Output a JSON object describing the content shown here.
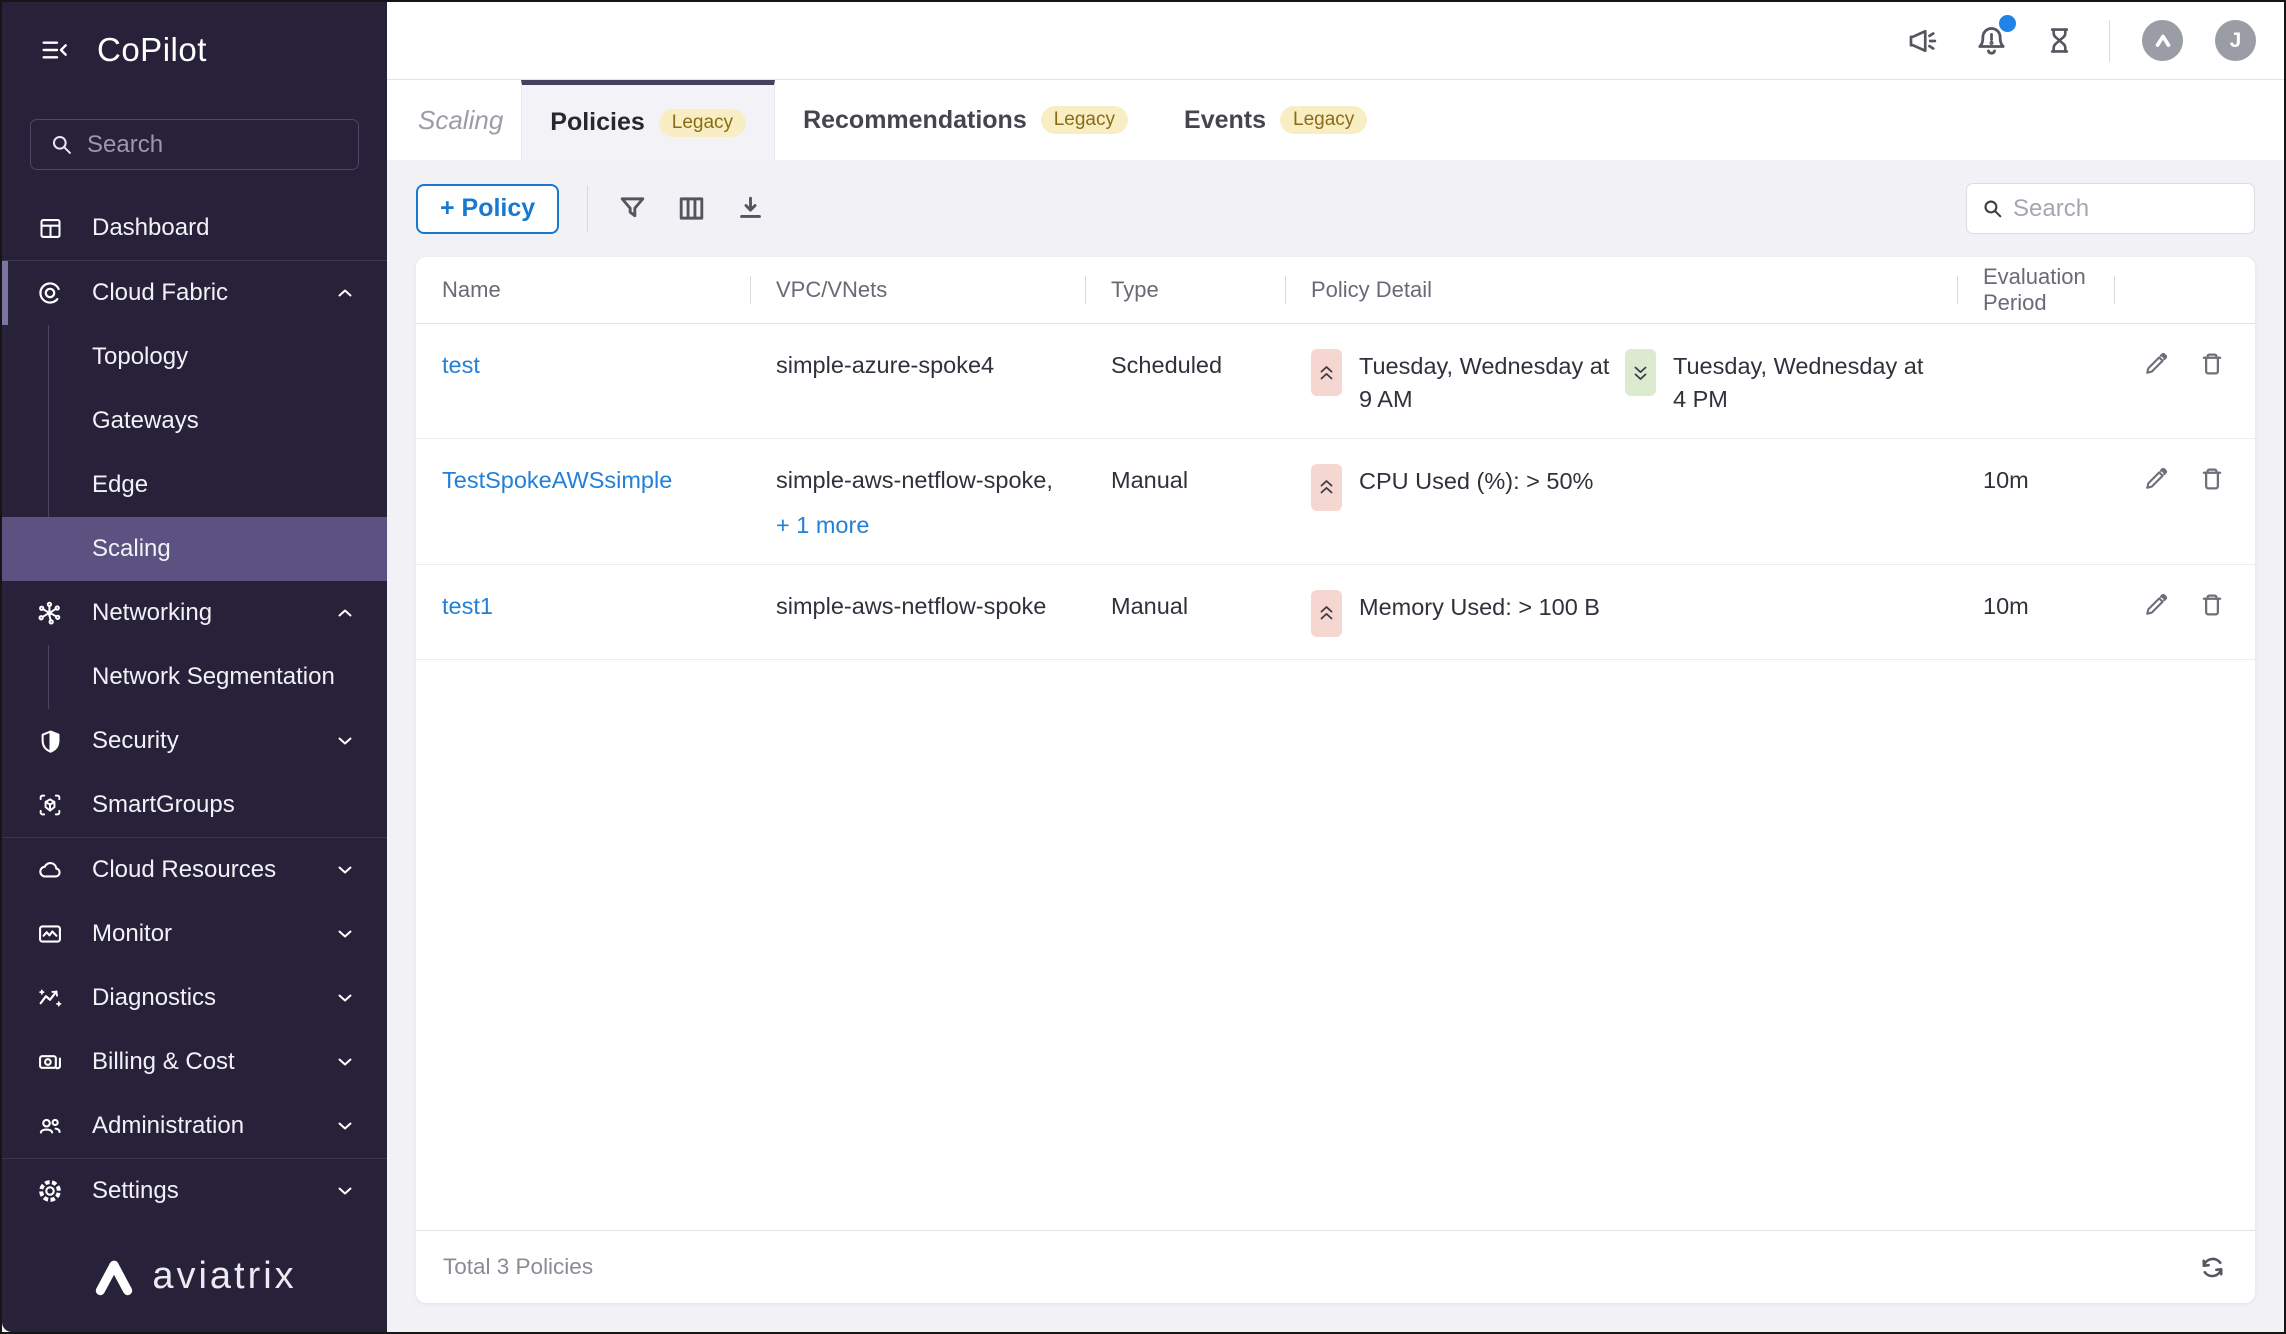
{
  "sidebar": {
    "app_title": "CoPilot",
    "search_placeholder": "Search",
    "items": [
      {
        "label": "Dashboard"
      },
      {
        "label": "Cloud Fabric",
        "expanded": true,
        "active_section": true,
        "children": [
          {
            "label": "Topology"
          },
          {
            "label": "Gateways"
          },
          {
            "label": "Edge"
          },
          {
            "label": "Scaling",
            "selected": true
          }
        ]
      },
      {
        "label": "Networking",
        "expanded": true,
        "children": [
          {
            "label": "Network Segmentation"
          }
        ]
      },
      {
        "label": "Security",
        "expanded": false
      },
      {
        "label": "SmartGroups"
      },
      {
        "label": "Cloud Resources",
        "expanded": false
      },
      {
        "label": "Monitor",
        "expanded": false
      },
      {
        "label": "Diagnostics",
        "expanded": false
      },
      {
        "label": "Billing & Cost",
        "expanded": false
      },
      {
        "label": "Administration",
        "expanded": false
      },
      {
        "label": "Settings",
        "expanded": false
      }
    ],
    "logo_text": "aviatrix"
  },
  "topbar": {
    "icons": [
      "announcements-icon",
      "notifications-bell-icon",
      "tasks-hourglass-icon"
    ],
    "has_notification_dot": true,
    "user_initial": "J"
  },
  "tabs": {
    "page_title": "Scaling",
    "items": [
      {
        "label": "Policies",
        "badge": "Legacy",
        "active": true
      },
      {
        "label": "Recommendations",
        "badge": "Legacy",
        "active": false
      },
      {
        "label": "Events",
        "badge": "Legacy",
        "active": false
      }
    ]
  },
  "toolbar": {
    "add_button_label": "+ Policy",
    "icons": [
      "filter-icon",
      "columns-icon",
      "download-icon"
    ],
    "search_placeholder": "Search"
  },
  "table": {
    "columns": [
      "Name",
      "VPC/VNets",
      "Type",
      "Policy Detail",
      "Evaluation Period"
    ],
    "rows": [
      {
        "name": "test",
        "vpc": "simple-azure-spoke4",
        "type": "Scheduled",
        "details": [
          {
            "direction": "up",
            "text": "Tuesday, Wednesday at 9 AM"
          },
          {
            "direction": "down",
            "text": "Tuesday, Wednesday at 4 PM"
          }
        ],
        "evaluation_period": ""
      },
      {
        "name": "TestSpokeAWSsimple",
        "vpc": "simple-aws-netflow-spoke,",
        "vpc_more": "+ 1 more",
        "type": "Manual",
        "details": [
          {
            "direction": "up",
            "text": "CPU Used (%): > 50%"
          }
        ],
        "evaluation_period": "10m"
      },
      {
        "name": "test1",
        "vpc": "simple-aws-netflow-spoke",
        "type": "Manual",
        "details": [
          {
            "direction": "up",
            "text": "Memory Used: > 100 B"
          }
        ],
        "evaluation_period": "10m"
      }
    ],
    "footer_total": "Total 3 Policies"
  },
  "colors": {
    "accent_blue": "#1879d0",
    "link_blue": "#2380d8",
    "sidebar_bg": "#272139",
    "sidebar_selected": "#5b5282",
    "active_tab_border": "#454060",
    "legacy_badge_bg": "#f8edc3",
    "legacy_badge_text": "#8a6c15",
    "scale_up_badge_bg": "#f6d6d1",
    "scale_down_badge_bg": "#dcebcf",
    "notification_dot": "#1f83e8",
    "page_bg": "#f2f2f6"
  }
}
